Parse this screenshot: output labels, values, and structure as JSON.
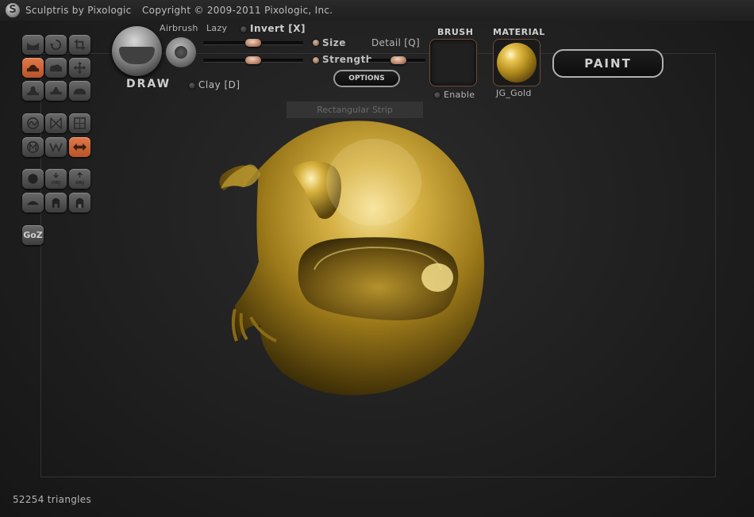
{
  "titlebar": {
    "app_title": "Sculptris by Pixologic",
    "copyright": "Copyright © 2009-2011 Pixologic, Inc."
  },
  "toolbar": {
    "brush_name": "DRAW",
    "airbrush_label": "Airbrush",
    "lazy_label": "Lazy",
    "invert_label": "Invert [X]",
    "size_label": "Size",
    "strength_label": "Strength",
    "detail_label": "Detail [Q]",
    "clay_label": "Clay [D]",
    "options_label": "OPTIONS",
    "size_value": 0.5,
    "strength_value": 0.5,
    "detail_value": 0.5
  },
  "brush_panel": {
    "heading": "BRUSH",
    "enable_label": "Enable"
  },
  "material_panel": {
    "heading": "MATERIAL",
    "material_name": "JG_Gold"
  },
  "paint_button": {
    "label": "PAINT"
  },
  "tooltip": {
    "text": "Rectangular Strip"
  },
  "status": {
    "triangles": "52254 triangles"
  },
  "tool_groups": [
    {
      "name": "sculpt-tools",
      "items": [
        "crease-icon",
        "rotate-icon",
        "scale-icon",
        "draw-icon",
        "flatten-icon",
        "grab-icon",
        "pinch-icon",
        "inflate-icon",
        "smooth-icon"
      ]
    },
    {
      "name": "symmetry-tools",
      "items": [
        "reduce-brush-icon",
        "wireframe-icon",
        "symmetry-icon",
        "mask-icon",
        "subdivide-icon",
        "mirror-icon"
      ]
    },
    {
      "name": "file-tools",
      "items": [
        "new-sphere-icon",
        "import-obj-icon",
        "export-obj-icon",
        "new-plane-icon",
        "open-icon",
        "save-icon"
      ]
    }
  ],
  "goz_label": "GoZ",
  "colors": {
    "accent": "#d06a3c",
    "background": "#1e1e1e",
    "gold": "#c9a030"
  }
}
